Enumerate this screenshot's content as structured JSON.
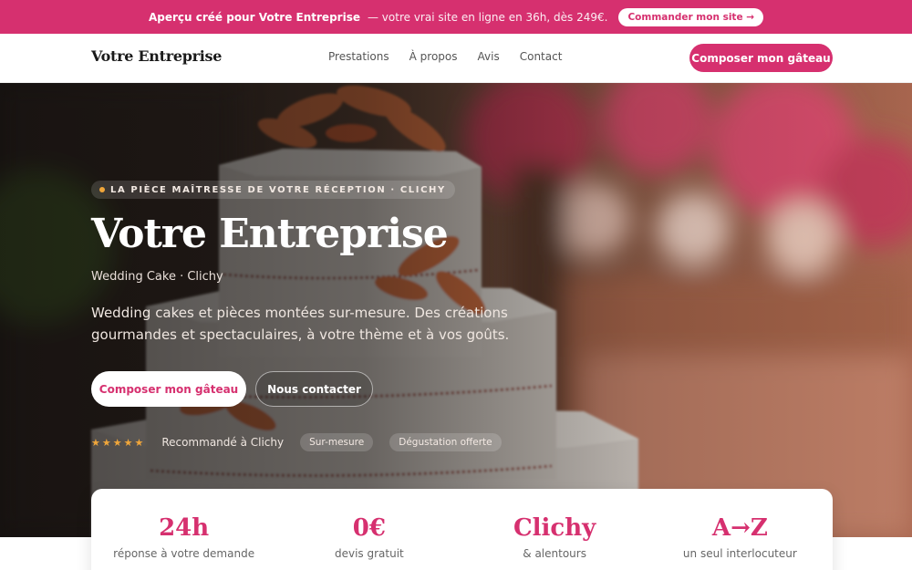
{
  "promo": {
    "lead": "Aperçu créé pour Votre Entreprise",
    "text": "— votre vrai site en ligne en 36h, dès 249€.",
    "cta": "Commander mon site →"
  },
  "header": {
    "brand": "Votre Entreprise",
    "nav": [
      "Prestations",
      "À propos",
      "Avis",
      "Contact"
    ],
    "cta": "Composer mon gâteau"
  },
  "hero": {
    "eyebrow": "LA PIÈCE MAÎTRESSE DE VOTRE RÉCEPTION · CLICHY",
    "title": "Votre Entreprise",
    "subtitle": "Wedding Cake · Clichy",
    "description": "Wedding cakes et pièces montées sur-mesure. Des créations gourmandes et spectaculaires, à votre thème et à vos goûts.",
    "primary_cta": "Composer mon gâteau",
    "secondary_cta": "Nous contacter",
    "stars": "★★★★★",
    "rating": 5,
    "recommendation": "Recommandé à Clichy",
    "badges": [
      "Sur-mesure",
      "Dégustation offerte"
    ]
  },
  "stats": [
    {
      "value": "24h",
      "label": "réponse à votre demande"
    },
    {
      "value": "0€",
      "label": "devis gratuit"
    },
    {
      "value": "Clichy",
      "label": "& alentours"
    },
    {
      "value": "A→Z",
      "label": "un seul interlocuteur"
    }
  ],
  "colors": {
    "accent": "#d6306f",
    "star": "#f0a63a"
  }
}
